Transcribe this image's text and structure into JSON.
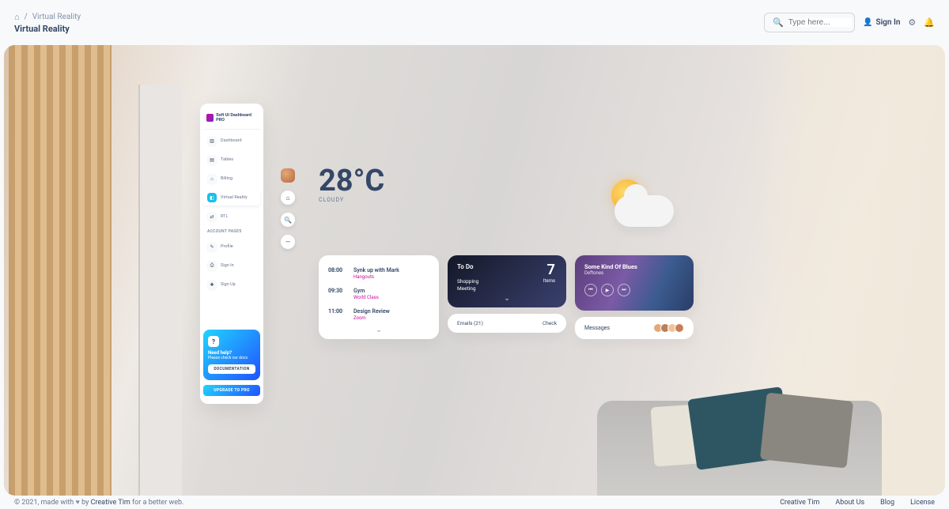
{
  "breadcrumb": {
    "current": "Virtual Reality"
  },
  "page_title": "Virtual Reality",
  "search": {
    "placeholder": "Type here..."
  },
  "top": {
    "sign_in": "Sign In"
  },
  "sidebar": {
    "brand": "Soft UI Dashboard PRO",
    "items": [
      {
        "icon": "▥",
        "label": "Dashboard"
      },
      {
        "icon": "▤",
        "label": "Tables"
      },
      {
        "icon": "⌂",
        "label": "Billing"
      },
      {
        "icon": "◧",
        "label": "Virtual Reality"
      },
      {
        "icon": "⇄",
        "label": "RTL"
      }
    ],
    "section_label": "Account Pages",
    "account_items": [
      {
        "icon": "✎",
        "label": "Profile"
      },
      {
        "icon": "⎙",
        "label": "Sign In"
      },
      {
        "icon": "✚",
        "label": "Sign Up"
      }
    ],
    "help": {
      "title": "Need help?",
      "sub": "Please check our docs",
      "button": "DOCUMENTATION"
    },
    "upgrade": "UPGRADE TO PRO"
  },
  "weather": {
    "temperature": "28°C",
    "condition": "CLOUDY"
  },
  "schedule": [
    {
      "time": "08:00",
      "title": "Synk up with Mark",
      "sub": "Hangouts"
    },
    {
      "time": "09:30",
      "title": "Gym",
      "sub": "World Class"
    },
    {
      "time": "11:00",
      "title": "Design Review",
      "sub": "Zoom"
    }
  ],
  "todo": {
    "title": "To Do",
    "count": "7",
    "count_label": "Items",
    "items": [
      "Shopping",
      "Meeting"
    ]
  },
  "emails": {
    "label": "Emails (21)",
    "action": "Check"
  },
  "music": {
    "title": "Some Kind Of Blues",
    "artist": "Deftones"
  },
  "messages": {
    "label": "Messages"
  },
  "footer": {
    "left_prefix": "© 2021, made with ",
    "left_by": " by ",
    "left_author": "Creative Tim",
    "left_suffix": " for a better web.",
    "links": [
      "Creative Tim",
      "About Us",
      "Blog",
      "License"
    ]
  }
}
